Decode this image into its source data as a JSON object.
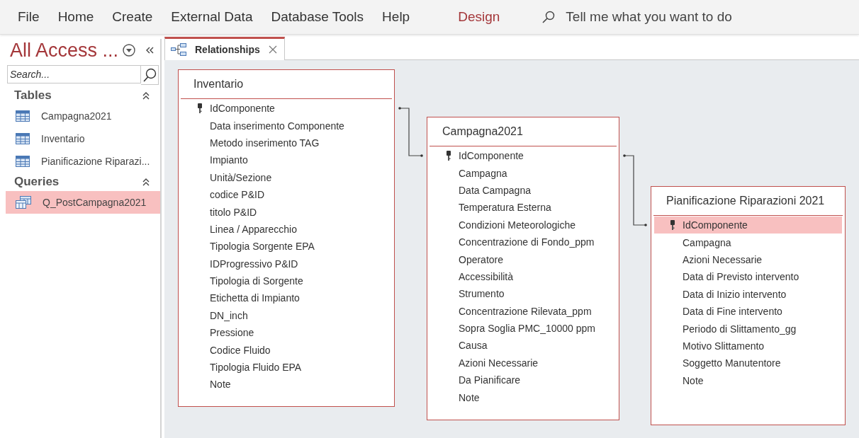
{
  "ribbon": {
    "tabs": [
      {
        "label": "File",
        "contextual": false
      },
      {
        "label": "Home",
        "contextual": false
      },
      {
        "label": "Create",
        "contextual": false
      },
      {
        "label": "External Data",
        "contextual": false
      },
      {
        "label": "Database Tools",
        "contextual": false
      },
      {
        "label": "Help",
        "contextual": false
      },
      {
        "label": "Design",
        "contextual": true
      }
    ],
    "tell_me": {
      "placeholder": "Tell me what you want to do"
    }
  },
  "navigation": {
    "title": "All Access ...",
    "search": {
      "placeholder": "Search..."
    },
    "groups": [
      {
        "label": "Tables",
        "items": [
          {
            "label": "Campagna2021",
            "kind": "table",
            "selected": false
          },
          {
            "label": "Inventario",
            "kind": "table",
            "selected": false
          },
          {
            "label": "Pianificazione Riparazi...",
            "kind": "table",
            "selected": false
          }
        ]
      },
      {
        "label": "Queries",
        "items": [
          {
            "label": "Q_PostCampagna2021",
            "kind": "query",
            "selected": true
          }
        ]
      }
    ]
  },
  "document_tab": {
    "label": "Relationships"
  },
  "tables": [
    {
      "title": "Inventario",
      "fields": [
        {
          "name": "IdComponente",
          "key": true,
          "selected": false
        },
        {
          "name": "Data inserimento Componente",
          "key": false,
          "selected": false
        },
        {
          "name": "Metodo inserimento TAG",
          "key": false,
          "selected": false
        },
        {
          "name": "Impianto",
          "key": false,
          "selected": false
        },
        {
          "name": "Unità/Sezione",
          "key": false,
          "selected": false
        },
        {
          "name": "codice P&ID",
          "key": false,
          "selected": false
        },
        {
          "name": "titolo P&ID",
          "key": false,
          "selected": false
        },
        {
          "name": "Linea / Apparecchio",
          "key": false,
          "selected": false
        },
        {
          "name": "Tipologia Sorgente EPA",
          "key": false,
          "selected": false
        },
        {
          "name": "IDProgressivo P&ID",
          "key": false,
          "selected": false
        },
        {
          "name": "Tipologia di Sorgente",
          "key": false,
          "selected": false
        },
        {
          "name": "Etichetta di Impianto",
          "key": false,
          "selected": false
        },
        {
          "name": "DN_inch",
          "key": false,
          "selected": false
        },
        {
          "name": "Pressione",
          "key": false,
          "selected": false
        },
        {
          "name": "Codice Fluido",
          "key": false,
          "selected": false
        },
        {
          "name": "Tipologia Fluido EPA",
          "key": false,
          "selected": false
        },
        {
          "name": "Note",
          "key": false,
          "selected": false
        }
      ]
    },
    {
      "title": "Campagna2021",
      "fields": [
        {
          "name": "IdComponente",
          "key": true,
          "selected": false
        },
        {
          "name": "Campagna",
          "key": false,
          "selected": false
        },
        {
          "name": "Data Campagna",
          "key": false,
          "selected": false
        },
        {
          "name": "Temperatura Esterna",
          "key": false,
          "selected": false
        },
        {
          "name": "Condizioni Meteorologiche",
          "key": false,
          "selected": false
        },
        {
          "name": "Concentrazione di Fondo_ppm",
          "key": false,
          "selected": false
        },
        {
          "name": "Operatore",
          "key": false,
          "selected": false
        },
        {
          "name": "Accessibilità",
          "key": false,
          "selected": false
        },
        {
          "name": "Strumento",
          "key": false,
          "selected": false
        },
        {
          "name": "Concentrazione Rilevata_ppm",
          "key": false,
          "selected": false
        },
        {
          "name": "Sopra Soglia PMC_10000 ppm",
          "key": false,
          "selected": false
        },
        {
          "name": "Causa",
          "key": false,
          "selected": false
        },
        {
          "name": "Azioni Necessarie",
          "key": false,
          "selected": false
        },
        {
          "name": "Da Pianificare",
          "key": false,
          "selected": false
        },
        {
          "name": "Note",
          "key": false,
          "selected": false
        }
      ]
    },
    {
      "title": "Pianificazione Riparazioni 2021",
      "fields": [
        {
          "name": "IdComponente",
          "key": true,
          "selected": true
        },
        {
          "name": "Campagna",
          "key": false,
          "selected": false
        },
        {
          "name": "Azioni Necessarie",
          "key": false,
          "selected": false
        },
        {
          "name": "Data di Previsto intervento",
          "key": false,
          "selected": false
        },
        {
          "name": "Data di Inizio intervento",
          "key": false,
          "selected": false
        },
        {
          "name": "Data di Fine intervento",
          "key": false,
          "selected": false
        },
        {
          "name": "Periodo di Slittamento_gg",
          "key": false,
          "selected": false
        },
        {
          "name": "Motivo Slittamento",
          "key": false,
          "selected": false
        },
        {
          "name": "Soggetto Manutentore",
          "key": false,
          "selected": false
        },
        {
          "name": "Note",
          "key": false,
          "selected": false
        }
      ]
    }
  ]
}
